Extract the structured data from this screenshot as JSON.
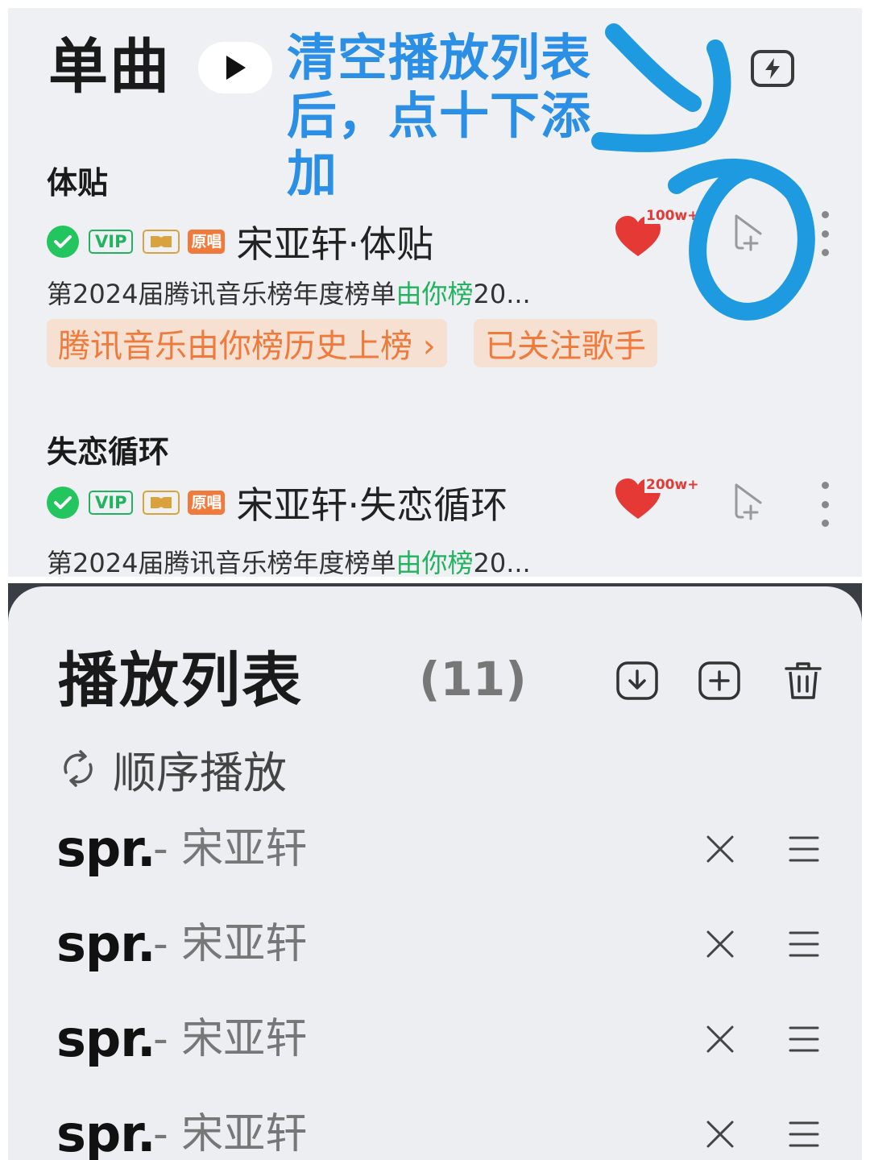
{
  "header": {
    "title": "单曲"
  },
  "annotation": {
    "lines": [
      "清空播放列表",
      "后，点十下添",
      "加"
    ]
  },
  "songs": [
    {
      "title": "体贴",
      "badges": {
        "vip": "VIP",
        "original": "原唱"
      },
      "name": "宋亚轩·体贴",
      "likes": "100w+",
      "subtitle_prefix": "第2024届腾讯音乐榜年度榜单",
      "subtitle_highlight": "由你榜",
      "subtitle_suffix": "20...",
      "tags": [
        "腾讯音乐由你榜历史上榜 ›",
        "已关注歌手"
      ]
    },
    {
      "title": "失恋循环",
      "badges": {
        "vip": "VIP",
        "original": "原唱"
      },
      "name": "宋亚轩·失恋循环",
      "likes": "200w+",
      "subtitle_prefix": "第2024届腾讯音乐榜年度榜单",
      "subtitle_highlight": "由你榜",
      "subtitle_suffix": "20..."
    }
  ],
  "playlist": {
    "title": "播放列表",
    "count": "(11)",
    "mode": "顺序播放",
    "items": [
      {
        "song": "spr.",
        "artist": "- 宋亚轩"
      },
      {
        "song": "spr.",
        "artist": "- 宋亚轩"
      },
      {
        "song": "spr.",
        "artist": "- 宋亚轩"
      },
      {
        "song": "spr.",
        "artist": "- 宋亚轩"
      }
    ]
  },
  "colors": {
    "accent_green": "#22b35e",
    "heart_red": "#e53935",
    "tag_orange": "#f07a3c",
    "annotation_blue": "#2b8fe6"
  },
  "icons": [
    "play-icon",
    "flash-icon",
    "check-icon",
    "dolby-icon",
    "heart-icon",
    "add-to-playlist-icon",
    "more-icon",
    "download-icon",
    "add-icon",
    "trash-icon",
    "repeat-icon",
    "close-icon",
    "drag-handle-icon"
  ]
}
